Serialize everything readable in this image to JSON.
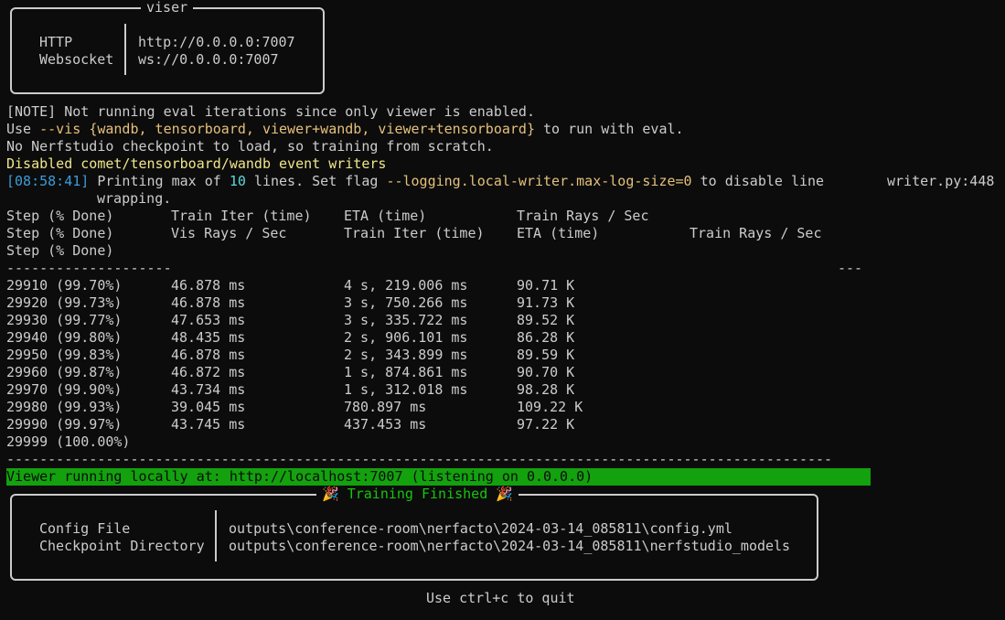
{
  "viser_box": {
    "title": "viser",
    "rows": [
      {
        "label": "HTTP",
        "value": "http://0.0.0.0:7007"
      },
      {
        "label": "Websocket",
        "value": "ws://0.0.0.0:7007"
      }
    ]
  },
  "note_lines": {
    "note": "[NOTE] Not running eval iterations since only viewer is enabled.",
    "use_prefix": "Use ",
    "vis_flag": "--vis",
    "vis_options": "{wandb, tensorboard, viewer+wandb, viewer+tensorboard}",
    "use_suffix": " to run with eval.",
    "checkpoint": "No Nerfstudio checkpoint to load, so training from scratch.",
    "disabled": "Disabled comet/tensorboard/wandb event writers"
  },
  "log_line": {
    "timestamp": "[08:58:41]",
    "text1": " Printing max of ",
    "num": "10",
    "text2": " lines. Set flag ",
    "flag": "--logging.local-writer.max-log-size=0",
    "text3": " to disable line",
    "text4": "wrapping.",
    "source": "writer.py:448"
  },
  "table": {
    "header_row1": [
      "Step (% Done)",
      "Train Iter (time)",
      "ETA (time)",
      "Train Rays / Sec"
    ],
    "header_row2": [
      "Step (% Done)",
      "Vis Rays / Sec",
      "Train Iter (time)",
      "ETA (time)",
      "Train Rays / Sec"
    ],
    "header_row3": "Step (% Done)",
    "dash_left": "--------------------",
    "dash_right": "---",
    "rows": [
      [
        "29910 (99.70%)",
        "46.878 ms",
        "4 s, 219.006 ms",
        "90.71 K"
      ],
      [
        "29920 (99.73%)",
        "46.878 ms",
        "3 s, 750.266 ms",
        "91.73 K"
      ],
      [
        "29930 (99.77%)",
        "47.653 ms",
        "3 s, 335.722 ms",
        "89.52 K"
      ],
      [
        "29940 (99.80%)",
        "48.435 ms",
        "2 s, 906.101 ms",
        "86.28 K"
      ],
      [
        "29950 (99.83%)",
        "46.878 ms",
        "2 s, 343.899 ms",
        "89.59 K"
      ],
      [
        "29960 (99.87%)",
        "46.872 ms",
        "1 s, 874.861 ms",
        "90.70 K"
      ],
      [
        "29970 (99.90%)",
        "43.734 ms",
        "1 s, 312.018 ms",
        "98.28 K"
      ],
      [
        "29980 (99.93%)",
        "39.045 ms",
        "780.897 ms",
        "109.22 K"
      ],
      [
        "29990 (99.97%)",
        "43.745 ms",
        "437.453 ms",
        "97.22 K"
      ]
    ],
    "last_row": "29999 (100.00%)",
    "bottom_rule": "----------------------------------------------------------------------------------------------------"
  },
  "viewer_status": "Viewer running locally at: http://localhost:7007 (listening on 0.0.0.0)",
  "finished_box": {
    "title": "🎉 Training Finished 🎉",
    "rows": [
      {
        "label": "Config File",
        "value": "outputs\\conference-room\\nerfacto\\2024-03-14_085811\\config.yml"
      },
      {
        "label": "Checkpoint Directory",
        "value": "outputs\\conference-room\\nerfacto\\2024-03-14_085811\\nerfstudio_models"
      }
    ]
  },
  "quit_hint": "Use ctrl+c to quit",
  "colors": {
    "background": "#0c0c0c",
    "text": "#cccccc",
    "yellow": "#e5c07b",
    "cyan": "#3b9dd9",
    "green_bar": "#13a10e",
    "green_text": "#16c60c"
  }
}
